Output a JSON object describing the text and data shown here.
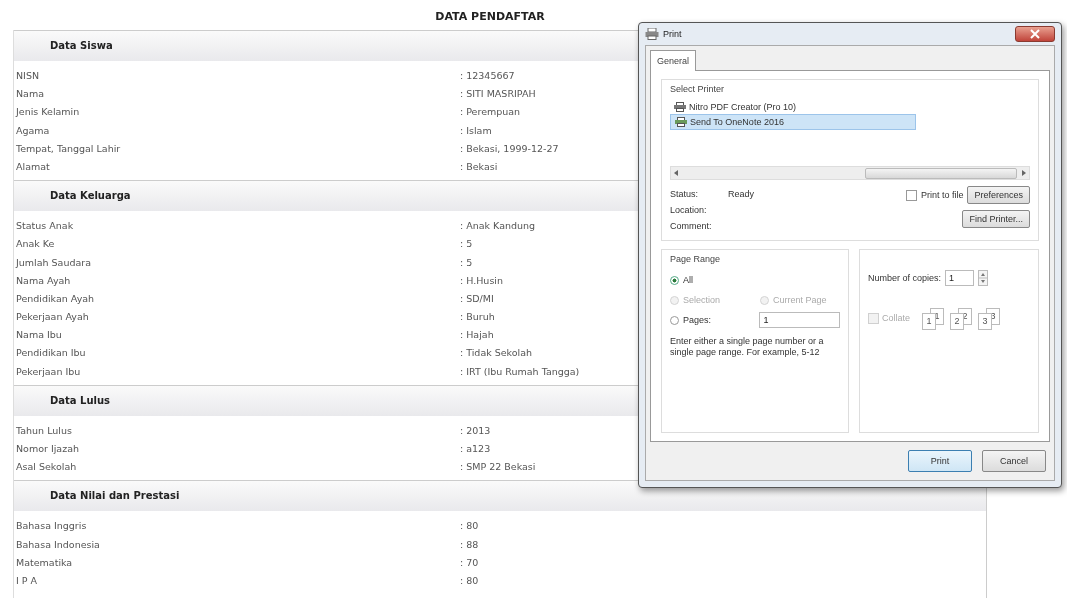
{
  "page_title": "DATA PENDAFTAR",
  "sections": [
    {
      "title": "Data Siswa",
      "rows": [
        {
          "label": "NISN",
          "value": ": 12345667"
        },
        {
          "label": "Nama",
          "value": ": SITI MASRIPAH"
        },
        {
          "label": "Jenis Kelamin",
          "value": ": Perempuan"
        },
        {
          "label": "Agama",
          "value": ": Islam"
        },
        {
          "label": "Tempat, Tanggal Lahir",
          "value": ": Bekasi, 1999-12-27"
        },
        {
          "label": "Alamat",
          "value": ": Bekasi"
        }
      ]
    },
    {
      "title": "Data Keluarga",
      "rows": [
        {
          "label": "Status Anak",
          "value": ": Anak Kandung"
        },
        {
          "label": "Anak Ke",
          "value": ": 5"
        },
        {
          "label": "Jumlah Saudara",
          "value": ": 5"
        },
        {
          "label": "Nama Ayah",
          "value": ": H.Husin"
        },
        {
          "label": "Pendidikan Ayah",
          "value": ": SD/MI"
        },
        {
          "label": "Pekerjaan Ayah",
          "value": ": Buruh"
        },
        {
          "label": "Nama Ibu",
          "value": ": Hajah"
        },
        {
          "label": "Pendidikan Ibu",
          "value": ": Tidak Sekolah"
        },
        {
          "label": "Pekerjaan Ibu",
          "value": ": IRT (Ibu Rumah Tangga)"
        }
      ]
    },
    {
      "title": "Data Lulus",
      "rows": [
        {
          "label": "Tahun Lulus",
          "value": ": 2013"
        },
        {
          "label": "Nomor Ijazah",
          "value": ": a123"
        },
        {
          "label": "Asal Sekolah",
          "value": ": SMP 22 Bekasi"
        }
      ]
    },
    {
      "title": "Data Nilai dan Prestasi",
      "rows": [
        {
          "label": "Bahasa Inggris",
          "value": ": 80"
        },
        {
          "label": "Bahasa Indonesia",
          "value": ": 88"
        },
        {
          "label": "Matematika",
          "value": ": 70"
        },
        {
          "label": "I P A",
          "value": ": 80"
        }
      ]
    }
  ],
  "dialog": {
    "title": "Print",
    "tabs": [
      {
        "label": "General",
        "selected": true
      }
    ],
    "select_printer": {
      "label": "Select Printer",
      "printers": [
        {
          "name": "Nitro PDF Creator (Pro 10)",
          "selected": false
        },
        {
          "name": "Send To OneNote 2016",
          "selected": true
        }
      ]
    },
    "status": {
      "label": "Status:",
      "value": "Ready"
    },
    "location": {
      "label": "Location:"
    },
    "comment": {
      "label": "Comment:"
    },
    "print_to_file": {
      "label": "Print to file",
      "checked": false
    },
    "preferences_button": "Preferences",
    "find_printer_button": "Find Printer...",
    "page_range": {
      "title": "Page Range",
      "options": [
        {
          "label": "All",
          "selected": true,
          "disabled": false
        },
        {
          "label": "Selection",
          "selected": false,
          "disabled": true
        },
        {
          "label": "Current Page",
          "selected": false,
          "disabled": true
        },
        {
          "label": "Pages:",
          "selected": false,
          "disabled": false
        }
      ],
      "pages_value": "1",
      "hint": "Enter either a single page number or a single page range.  For example, 5-12"
    },
    "copies": {
      "label": "Number of copies:",
      "value": "1"
    },
    "collate": {
      "label": "Collate",
      "checked": false,
      "disabled": true,
      "stacks": [
        {
          "back": "1",
          "front": "1"
        },
        {
          "back": "2",
          "front": "2"
        },
        {
          "back": "3",
          "front": "3"
        }
      ]
    },
    "buttons": [
      {
        "label": "Print",
        "kind": "default"
      },
      {
        "label": "Cancel",
        "kind": "normal"
      }
    ]
  }
}
